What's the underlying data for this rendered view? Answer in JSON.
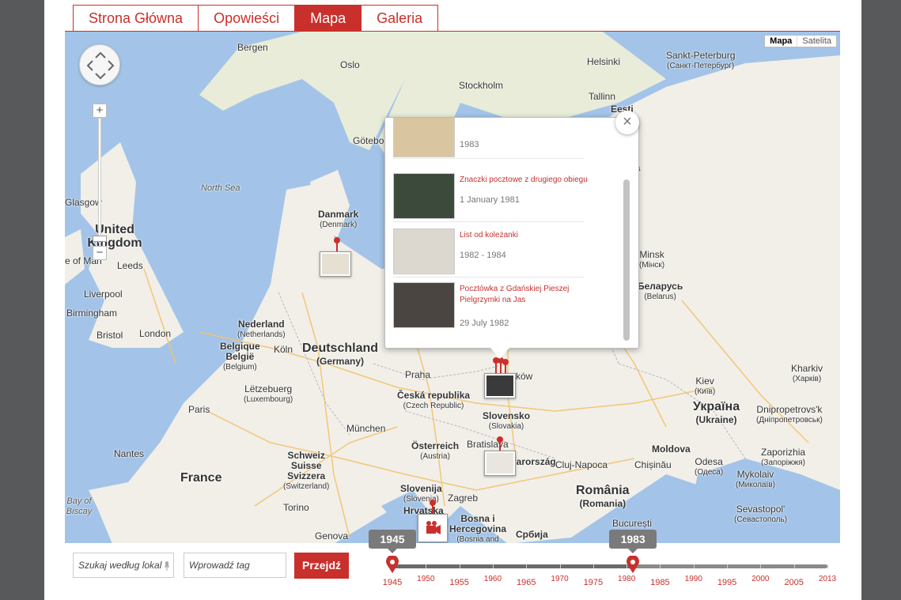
{
  "nav": {
    "tabs": [
      {
        "label": "Strona Główna",
        "active": false
      },
      {
        "label": "Opowieści",
        "active": false
      },
      {
        "label": "Mapa",
        "active": true
      },
      {
        "label": "Galeria",
        "active": false
      }
    ]
  },
  "map": {
    "type_buttons": [
      "Mapa",
      "Satelita"
    ],
    "selected_type": "Mapa",
    "labels": {
      "bergen": "Bergen",
      "oslo": "Oslo",
      "helsinki": "Helsinki",
      "sankt_petersburg": "Sankt-Peterburg",
      "sankt_petersburg_native": "(Санкт-Петербург)",
      "stockholm": "Stockholm",
      "tallinn": "Tallinn",
      "eesti": "Eesti",
      "goteborg": "Göteborg",
      "north_sea": "North Sea",
      "glasgow": "Glasgow",
      "danmark": "Danmark",
      "danmark_native": "(Denmark)",
      "united_kingdom": "United Kingdom",
      "isle_of_man": "e of Man",
      "leeds": "Leeds",
      "liverpool": "Liverpool",
      "birmingham": "Birmingham",
      "bristol": "Bristol",
      "london": "London",
      "nederland": "Nederland",
      "nederland_native": "(Netherlands)",
      "belgique": "Belgique",
      "belgie": "België",
      "belgie_native": "(Belgium)",
      "koln": "Köln",
      "deutschland": "Deutschland",
      "deutschland_native": "(Germany)",
      "letzebuerg": "Lëtzebuerg",
      "letzebuerg_native": "(Luxembourg)",
      "paris": "Paris",
      "france": "France",
      "nantes": "Nantes",
      "bay_of_biscay": "Bay of Biscay",
      "praha": "Praha",
      "ceska": "Česká republika",
      "ceska_native": "(Czech Republic)",
      "munchen": "München",
      "osterreich": "Österreich",
      "osterreich_native": "(Austria)",
      "bratislava": "Bratislava",
      "slovensko": "Slovensko",
      "slovensko_native": "(Slovakia)",
      "krakow": "ków",
      "schweiz": "Schweiz",
      "suisse": "Suisse",
      "svizzera": "Svizzera",
      "svizzera_native": "(Switzerland)",
      "torino": "Torino",
      "genova": "Genova",
      "slovenija": "Slovenija",
      "slovenija_native": "(Slovenia)",
      "zagreb": "Zagreb",
      "hrvatska": "Hrvatska",
      "bosna": "Bosna i",
      "hercegovina": "Hercegovina",
      "bosnia": "(Bosnia and",
      "srbija": "Србија",
      "magyarorszag": "Magyarország",
      "cluj": "Cluj-Napoca",
      "romania": "România",
      "romania_native": "(Romania)",
      "bucuresti": "București",
      "chisinau": "Chișinău",
      "moldova": "Moldova",
      "odesa": "Odesa",
      "odesa_native": "(Одеса)",
      "mykolaiv": "Mykolaiv",
      "mykolaiv_native": "(Миколаїв)",
      "sevastopol": "Sevastopol'",
      "sevastopol_native": "(Севастополь)",
      "minsk": "Minsk",
      "minsk_native": "(Мінск)",
      "belarus": "Беларусь",
      "belarus_native": "(Belarus)",
      "kiev": "Kiev",
      "kiev_native": "(Київ)",
      "ukraina": "Україна",
      "ukraina_native": "(Ukraine)",
      "kharkiv": "Kharkiv",
      "kharkiv_native": "(Харків)",
      "dnipro": "Dnipropetrovs'k",
      "dnipro_native": "(Дніпропетровськ)",
      "zaporizhia": "Zaporizhia",
      "zaporizhia_native": "(Запоріжжя)",
      "ija": "ija"
    }
  },
  "popup": {
    "items": [
      {
        "title": "",
        "date": "1983"
      },
      {
        "title": "Znaczki pocztowe z drugiego obiegu",
        "date": "1 January 1981"
      },
      {
        "title": "List od koleżanki",
        "date": "1982 - 1984"
      },
      {
        "title": "Pocztówka z Gdańskiej Pieszej Pielgrzymki na Jas",
        "date": "29 July 1982"
      }
    ],
    "close_label": "×"
  },
  "search": {
    "placeholder": "Szukaj według lokal",
    "tag_placeholder": "Wprowadź tag",
    "go_label": "Przejdź"
  },
  "timeline": {
    "start_value": "1945",
    "end_value": "1983",
    "min": 1945,
    "max": 2013,
    "start_fraction": 0.0,
    "end_fraction": 0.553,
    "ticks": [
      "1945",
      "1950",
      "1955",
      "1960",
      "1965",
      "1970",
      "1975",
      "1980",
      "1985",
      "1990",
      "1995",
      "2000",
      "2005",
      "2013"
    ]
  },
  "colors": {
    "accent": "#c9302c",
    "sea": "#a3c4e8",
    "land": "#f1efe8"
  }
}
